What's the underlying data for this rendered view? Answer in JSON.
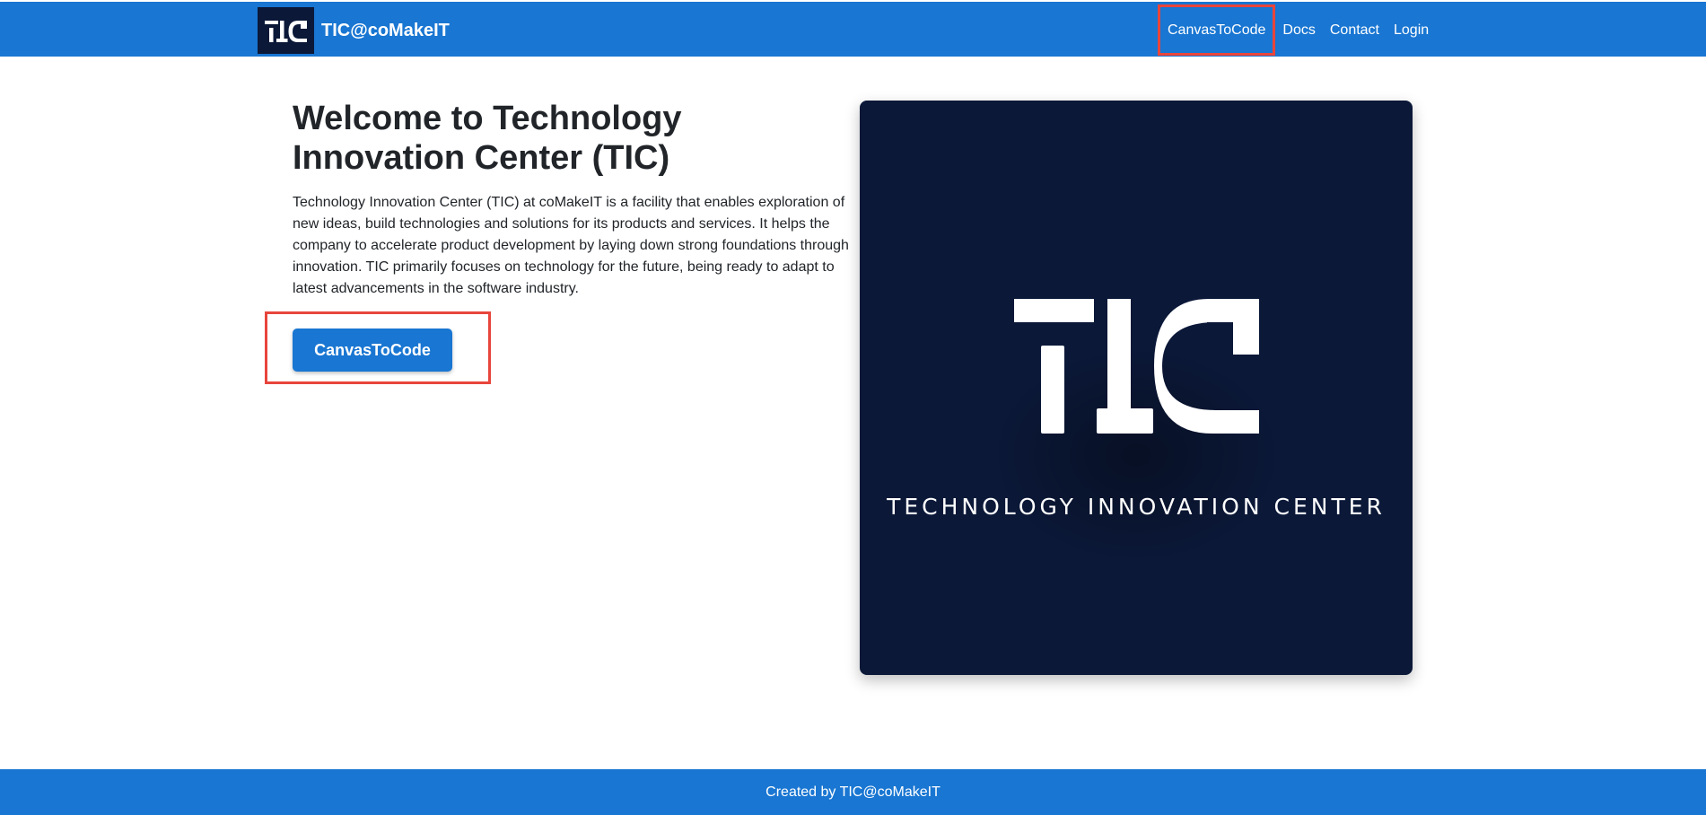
{
  "navbar": {
    "brand_name": "TIC@coMakeIT",
    "logo_icon": "tic-logo",
    "links": [
      {
        "label": "CanvasToCode",
        "highlighted": true
      },
      {
        "label": "Docs"
      },
      {
        "label": "Contact"
      },
      {
        "label": "Login"
      }
    ]
  },
  "hero": {
    "title": "Welcome to Technology Innovation Center (TIC)",
    "description": "Technology Innovation Center (TIC) at coMakeIT is a facility that enables exploration of new ideas, build technologies and solutions for its products and services. It helps the company to accelerate product development by laying down strong foundations through innovation. TIC primarily focuses on technology for the future, being ready to adapt to latest advancements in the software industry.",
    "cta_label": "CanvasToCode"
  },
  "image_panel": {
    "logo_icon": "tic-logo",
    "tagline": "TECHNOLOGY INNOVATION CENTER"
  },
  "footer": {
    "text": "Created by TIC@coMakeIT"
  },
  "colors": {
    "primary": "#1976d2",
    "dark_navy": "#0b1838",
    "highlight_border": "#e8453c"
  }
}
